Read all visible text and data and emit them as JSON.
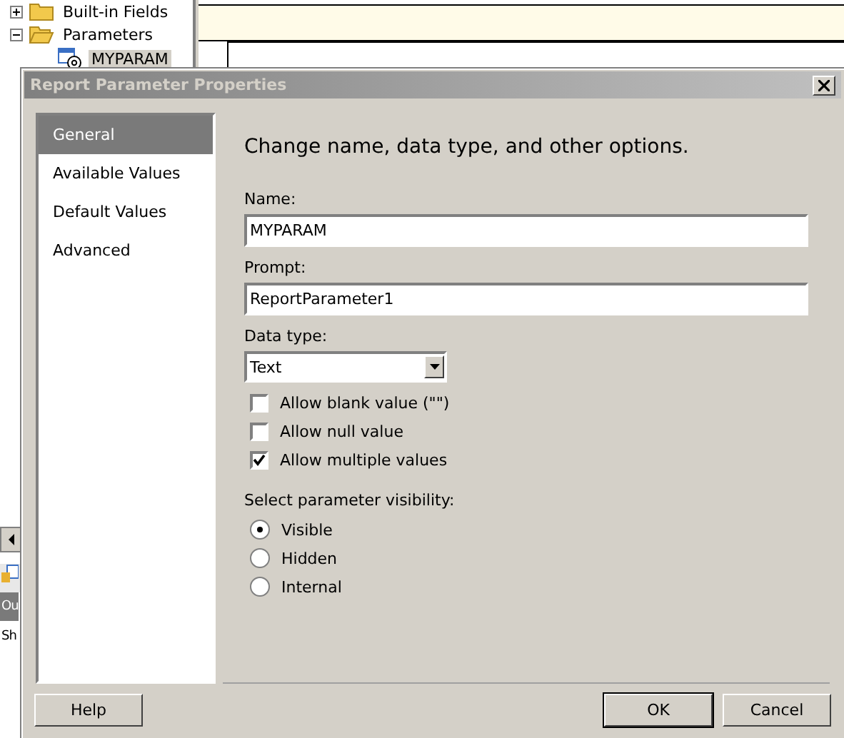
{
  "background": {
    "tree": [
      {
        "label": "Built-in Fields",
        "expanded": false
      },
      {
        "label": "Parameters",
        "expanded": true,
        "children": [
          {
            "label": "MYPARAM",
            "selected": true
          }
        ]
      }
    ],
    "panel_tab": "Ou",
    "panel_item": "Sh"
  },
  "dialog": {
    "title": "Report Parameter Properties",
    "nav": [
      {
        "label": "General",
        "selected": true
      },
      {
        "label": "Available Values",
        "selected": false
      },
      {
        "label": "Default Values",
        "selected": false
      },
      {
        "label": "Advanced",
        "selected": false
      }
    ],
    "heading": "Change name, data type, and other options.",
    "name": {
      "label": "Name:",
      "value": "MYPARAM"
    },
    "prompt": {
      "label": "Prompt:",
      "value": "ReportParameter1"
    },
    "data_type": {
      "label": "Data type:",
      "value": "Text"
    },
    "options": [
      {
        "label": "Allow blank value (\"\")",
        "checked": false
      },
      {
        "label": "Allow null value",
        "checked": false
      },
      {
        "label": "Allow multiple values",
        "checked": true
      }
    ],
    "visibility": {
      "label": "Select parameter visibility:",
      "options": [
        {
          "label": "Visible",
          "selected": true
        },
        {
          "label": "Hidden",
          "selected": false
        },
        {
          "label": "Internal",
          "selected": false
        }
      ]
    },
    "help": "Help",
    "buttons": [
      {
        "label": "OK",
        "default": true
      },
      {
        "label": "Cancel",
        "default": false
      }
    ]
  }
}
